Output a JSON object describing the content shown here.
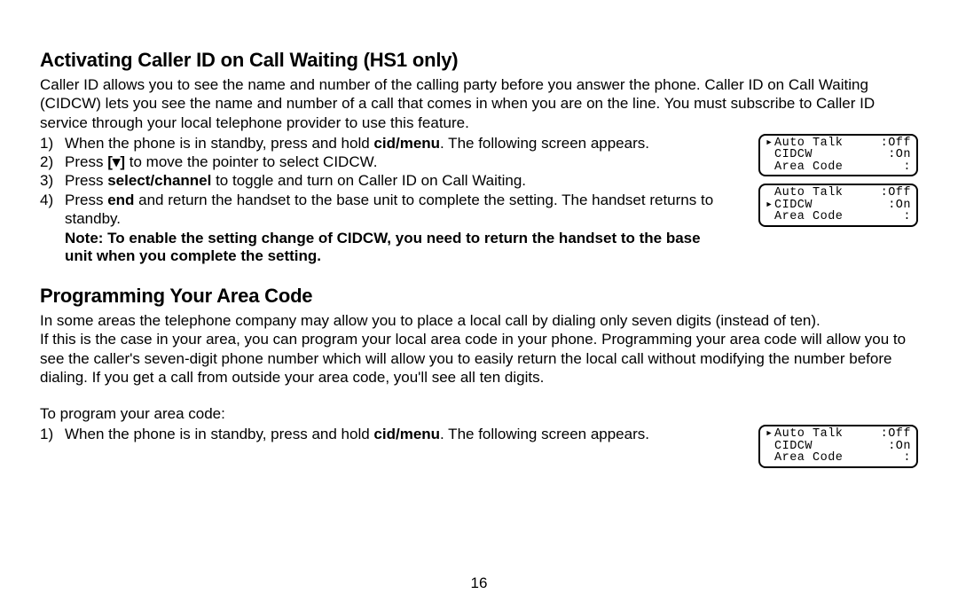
{
  "section1": {
    "heading": "Activating Caller ID on Call Waiting (HS1 only)",
    "intro": "Caller ID allows you to see the name and number of the calling party before you answer the phone. Caller ID on Call Waiting (CIDCW) lets you see the name and number of a call that comes in when you are on the line. You must subscribe to Caller ID service through your local telephone provider to use this feature.",
    "steps": [
      {
        "n": "1)",
        "a": "When the phone is in standby, press and hold ",
        "b": "cid/menu",
        "c": ". The following screen appears."
      },
      {
        "n": "2)",
        "a": "Press ",
        "b": "[▾]",
        "c": " to move the pointer to select CIDCW."
      },
      {
        "n": "3)",
        "a": "Press ",
        "b": "select/channel",
        "c": " to toggle and turn on Caller ID on Call Waiting."
      },
      {
        "n": "4)",
        "a": "Press ",
        "b": "end",
        "c": " and return the handset to the base unit to complete the setting. The handset returns to standby."
      }
    ],
    "note": "Note: To enable the setting change of CIDCW, you need to return the handset to the base unit when you complete the setting.",
    "screen1": {
      "r1": {
        "ptr": "▸",
        "label": "Auto Talk",
        "val": ":Off"
      },
      "r2": {
        "ptr": " ",
        "label": "CIDCW",
        "val": ":On"
      },
      "r3": {
        "ptr": " ",
        "label": "Area Code",
        "val": ":"
      }
    },
    "screen2": {
      "r1": {
        "ptr": " ",
        "label": "Auto Talk",
        "val": ":Off"
      },
      "r2": {
        "ptr": "▸",
        "label": "CIDCW",
        "val": ":On"
      },
      "r3": {
        "ptr": " ",
        "label": "Area Code",
        "val": ":"
      }
    }
  },
  "section2": {
    "heading": "Programming Your Area Code",
    "p1": "In some areas the telephone company may allow you to place a local call by dialing only seven digits (instead of ten).",
    "p2": "If this is the case in your area, you can program your local area code in your phone. Programming your area code will allow you to see the caller's seven-digit phone number which will allow you to easily return the local call without modifying the number before dialing. If you get a call from outside your area code, you'll see all ten digits.",
    "pre": "To program your area code:",
    "steps": [
      {
        "n": "1)",
        "a": "When the phone is in standby, press and hold ",
        "b": "cid/menu",
        "c": ". The following screen appears."
      }
    ],
    "screen": {
      "r1": {
        "ptr": "▸",
        "label": "Auto Talk",
        "val": ":Off"
      },
      "r2": {
        "ptr": " ",
        "label": "CIDCW",
        "val": ":On"
      },
      "r3": {
        "ptr": " ",
        "label": "Area Code",
        "val": ":"
      }
    }
  },
  "page": "16"
}
